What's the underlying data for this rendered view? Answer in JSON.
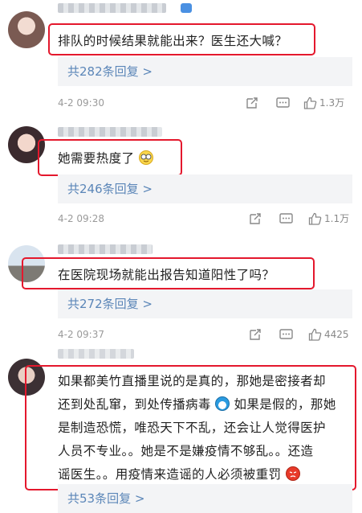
{
  "comments": [
    {
      "text": "排队的时候结果就能出来？医生还大喊？",
      "replies_label": "共282条回复 >",
      "time": "4-2 09:30",
      "likes": "1.3万"
    },
    {
      "text": "她需要热度了",
      "emoji": "glasses-smiley-emoji",
      "replies_label": "共246条回复 >",
      "time": "4-2 09:28",
      "likes": "1.1万"
    },
    {
      "text": "在医院现场就能出报告知道阳性了吗？",
      "replies_label": "共272条回复 >",
      "time": "4-2 09:37",
      "likes": "4425"
    },
    {
      "lines": [
        "如果都美竹直播里说的是真的，那她是密接者却",
        "还到处乱窜，到处传播病毒",
        "如果是假的，那她",
        "是制造恐慌，唯恐天下不乱，还会让人觉得医护",
        "人员不专业。。她是不是嫌疫情不够乱。。还造",
        "谣医生。。用疫情来造谣的人必须被重罚"
      ],
      "replies_label": "共53条回复 >"
    }
  ],
  "colors": {
    "highlight": "#e4182d",
    "link": "#5b86b8",
    "reply_bg": "#f3f4f6"
  }
}
